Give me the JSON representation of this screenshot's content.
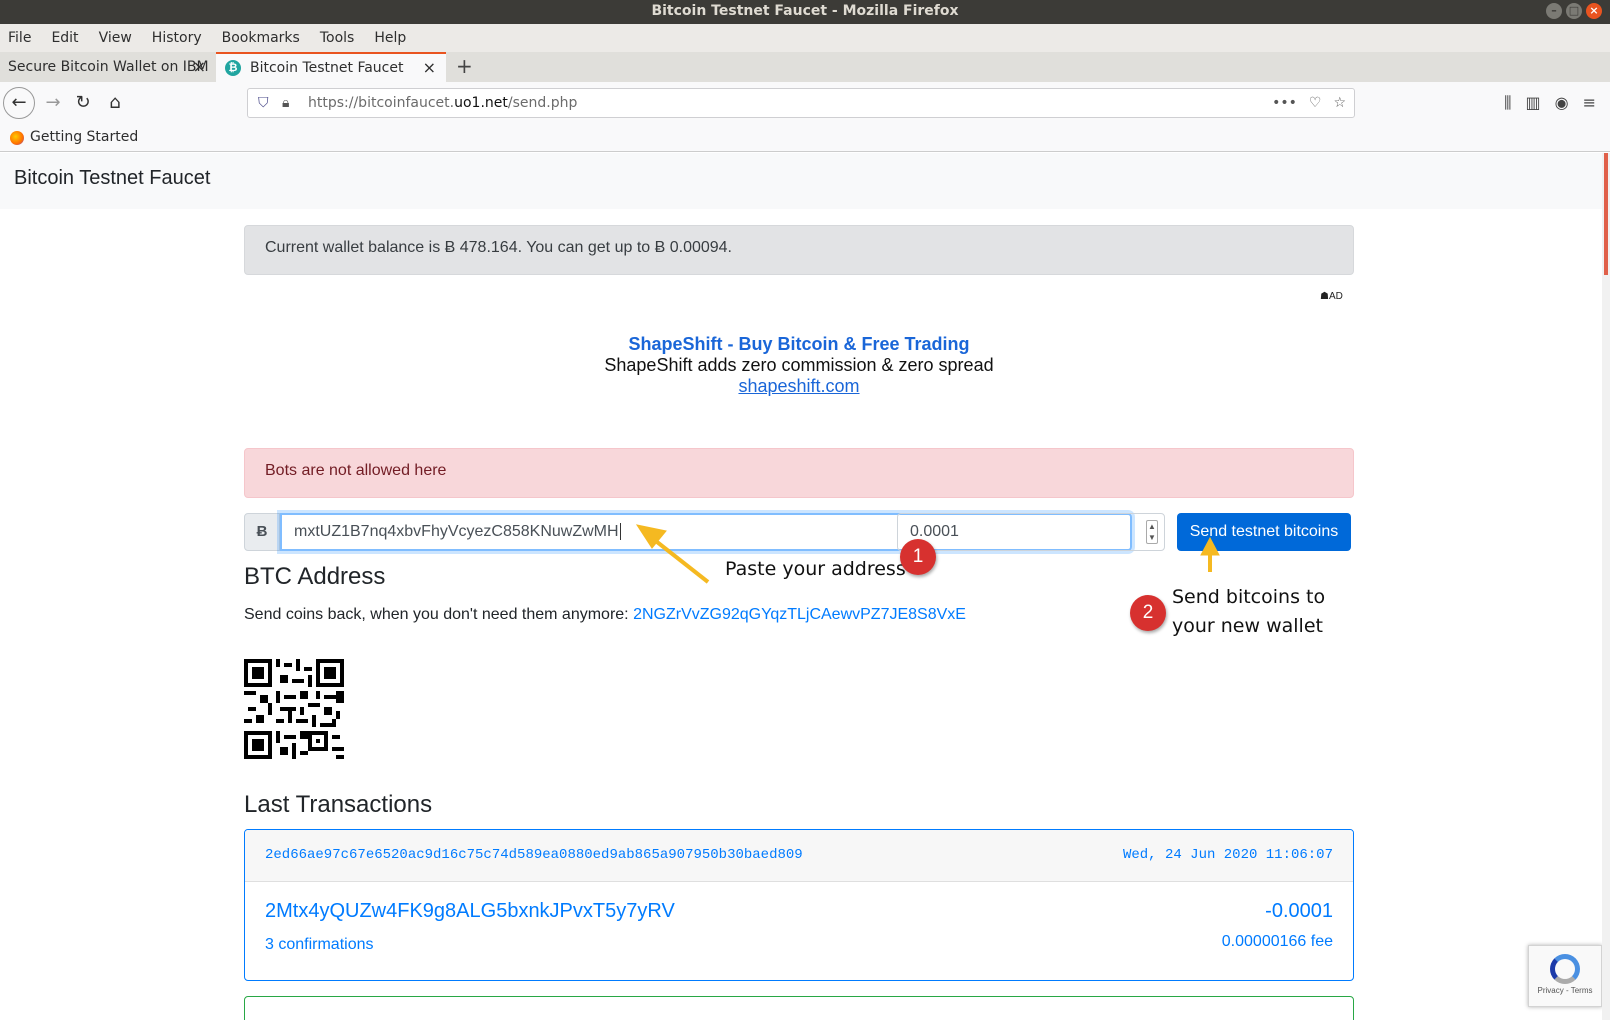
{
  "window": {
    "title": "Bitcoin Testnet Faucet - Mozilla Firefox"
  },
  "menu": [
    "File",
    "Edit",
    "View",
    "History",
    "Bookmarks",
    "Tools",
    "Help"
  ],
  "tabs": [
    {
      "label": "Secure Bitcoin Wallet on IBM"
    },
    {
      "label": "Bitcoin Testnet Faucet"
    }
  ],
  "url": {
    "prefix": "https://bitcoinfaucet.",
    "domain": "uo1.net",
    "path": "/send.php"
  },
  "bookmarks": {
    "item": "Getting Started"
  },
  "site": {
    "brand": "Bitcoin Testnet Faucet",
    "balance_text": "Current wallet balance is Ƀ 478.164. You can get up to Ƀ 0.00094.",
    "ad_tag": "AD",
    "ad": {
      "title": "ShapeShift - Buy Bitcoin & Free Trading",
      "desc": "ShapeShift adds zero commission & zero spread",
      "link": "shapeshift.com"
    },
    "bots_alert": "Bots are not allowed here",
    "form": {
      "prefix": "Ƀ",
      "address_value": "mxtUZ1B7nq4xbvFhyVcyezC858KNuwZwMH",
      "amount_value": "0.0001",
      "send_label": "Send testnet bitcoins"
    },
    "btc_heading": "BTC Address",
    "sendback_text": "Send coins back, when you don't need them anymore: ",
    "sendback_address": "2NGZrVvZG92qGYqzTLjCAewvPZ7JE8S8VxE",
    "last_heading": "Last Transactions",
    "transactions": [
      {
        "hash": "2ed66ae97c67e6520ac9d16c75c74d589ea0880ed9ab865a907950b30baed809",
        "date": "Wed, 24 Jun 2020 11:06:07",
        "address": "2Mtx4yQUZw4FK9g8ALG5bxnkJPvxT5y7yRV",
        "amount": "-0.0001",
        "confirmations": "3 confirmations",
        "fee": "0.00000166 fee"
      }
    ],
    "recaptcha": "Privacy - Terms"
  },
  "annotations": {
    "step1_number": "1",
    "step1_text": "Paste your address",
    "step2_number": "2",
    "step2_text_line1": "Send bitcoins to",
    "step2_text_line2": "your new wallet"
  },
  "colors": {
    "accent": "#e95420",
    "primary": "#007bff",
    "annotation_arrow": "#f5b921",
    "badge": "#d7312f"
  }
}
